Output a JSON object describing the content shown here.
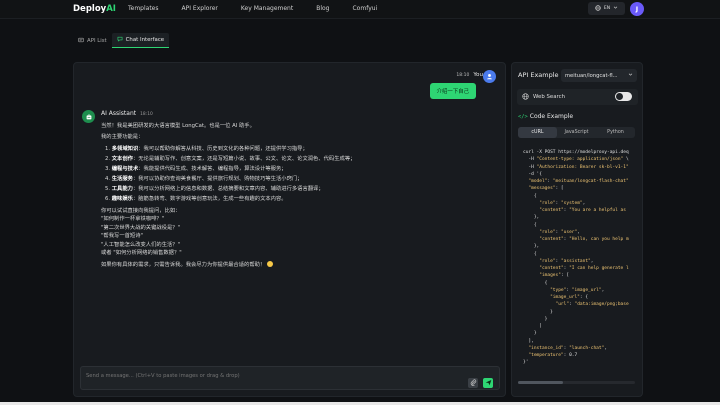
{
  "brand": {
    "name_a": "Deploy",
    "name_b": "AI"
  },
  "nav": [
    "Templates",
    "API Explorer",
    "Key Management",
    "Blog",
    "Comfyui"
  ],
  "lang": "EN",
  "user_initial": "J",
  "tabs": [
    {
      "label": "API List",
      "icon": "list-icon"
    },
    {
      "label": "Chat Interface",
      "icon": "chat-icon"
    }
  ],
  "user_message": {
    "time": "18:10",
    "author": "You",
    "text": "介绍一下自己"
  },
  "ai_message": {
    "author": "AI Assistant",
    "time": "18:10",
    "intro": "当然！我是美团研发的大语言模型 LongCat。也是一位 AI 助手。",
    "caps_title": "我的主要功能是：",
    "items": [
      {
        "num": "1.",
        "bold": "多领域知识",
        "text": "：我可以帮助你解答从科技、历史到文化的各种问题，还提供学习指导；"
      },
      {
        "num": "2.",
        "bold": "文本创作",
        "text": "：无论是辅助写作、创意文案，还是写短篇小说、故事、公文、论文、论文润色、代码生成等；"
      },
      {
        "num": "3.",
        "bold": "编程与技术",
        "text": "：我能提供代码生成、技术解答、编程指导，算法设计等服务；"
      },
      {
        "num": "4.",
        "bold": "生活服务",
        "text": "：我可以协助你查询美食餐厅、提供旅行规划、购物技巧等生活小窍门；"
      },
      {
        "num": "5.",
        "bold": "工具能力",
        "text": "：我可以分析网络上的信息和数据、总结摘要和文章内容、辅助进行多语言翻译；"
      },
      {
        "num": "6.",
        "bold": "趣味娱乐",
        "text": "：脑筋急转弯、数字游戏等创意玩法，生成一些有趣的文本内容。"
      }
    ],
    "ask_title": "你可以试试直接向我提问，比如：",
    "questions": [
      "\"如何制作一杯拿铁咖啡？\"",
      "\"第二次世界大战的关键战役是？\"",
      "\"帮我写一首短诗\"",
      "\"人工智能怎么改变人们的生活？\"",
      "或者 \"如何分析网络的销售数据？\""
    ],
    "closing": "如果你有具体的需求，只需告诉我。我会尽力为你提供最合适的帮助！"
  },
  "input": {
    "placeholder": "Send a message... (Ctrl+V to paste images or drag & drop)"
  },
  "api": {
    "title": "API Example",
    "model": "meituan/longcat-fl...",
    "web_search": "Web Search",
    "web_search_on": true,
    "code_title": "Code Example",
    "lang_tabs": [
      "cURL",
      "JavaScript",
      "Python"
    ],
    "code": [
      "curl -X POST https://modelproxy-api.deq",
      "  -H \"Content-type: application/json\" \\",
      "  -H \"Authorization: Bearer sk-bl-v1-1\"",
      "  -d '{",
      "  \"model\": \"meituan/longcat-flash-chat\"",
      "  \"messages\": [",
      "    {",
      "      \"role\": \"system\",",
      "      \"content\": \"You are a helpful as",
      "    },",
      "    {",
      "      \"role\": \"user\",",
      "      \"content\": \"Hello, can you help m",
      "    },",
      "    {",
      "      \"role\": \"assistant\",",
      "      \"content\": \"I can help generate l",
      "      \"images\": [",
      "        {",
      "          \"type\": \"image_url\",",
      "          \"image_url\": {",
      "            \"url\": \"data:image/png;base",
      "          }",
      "        }",
      "      ]",
      "    }",
      "  ],",
      "  \"instance_id\": \"launch-chat\",",
      "  \"temperature\": 0.7",
      "}'"
    ]
  }
}
